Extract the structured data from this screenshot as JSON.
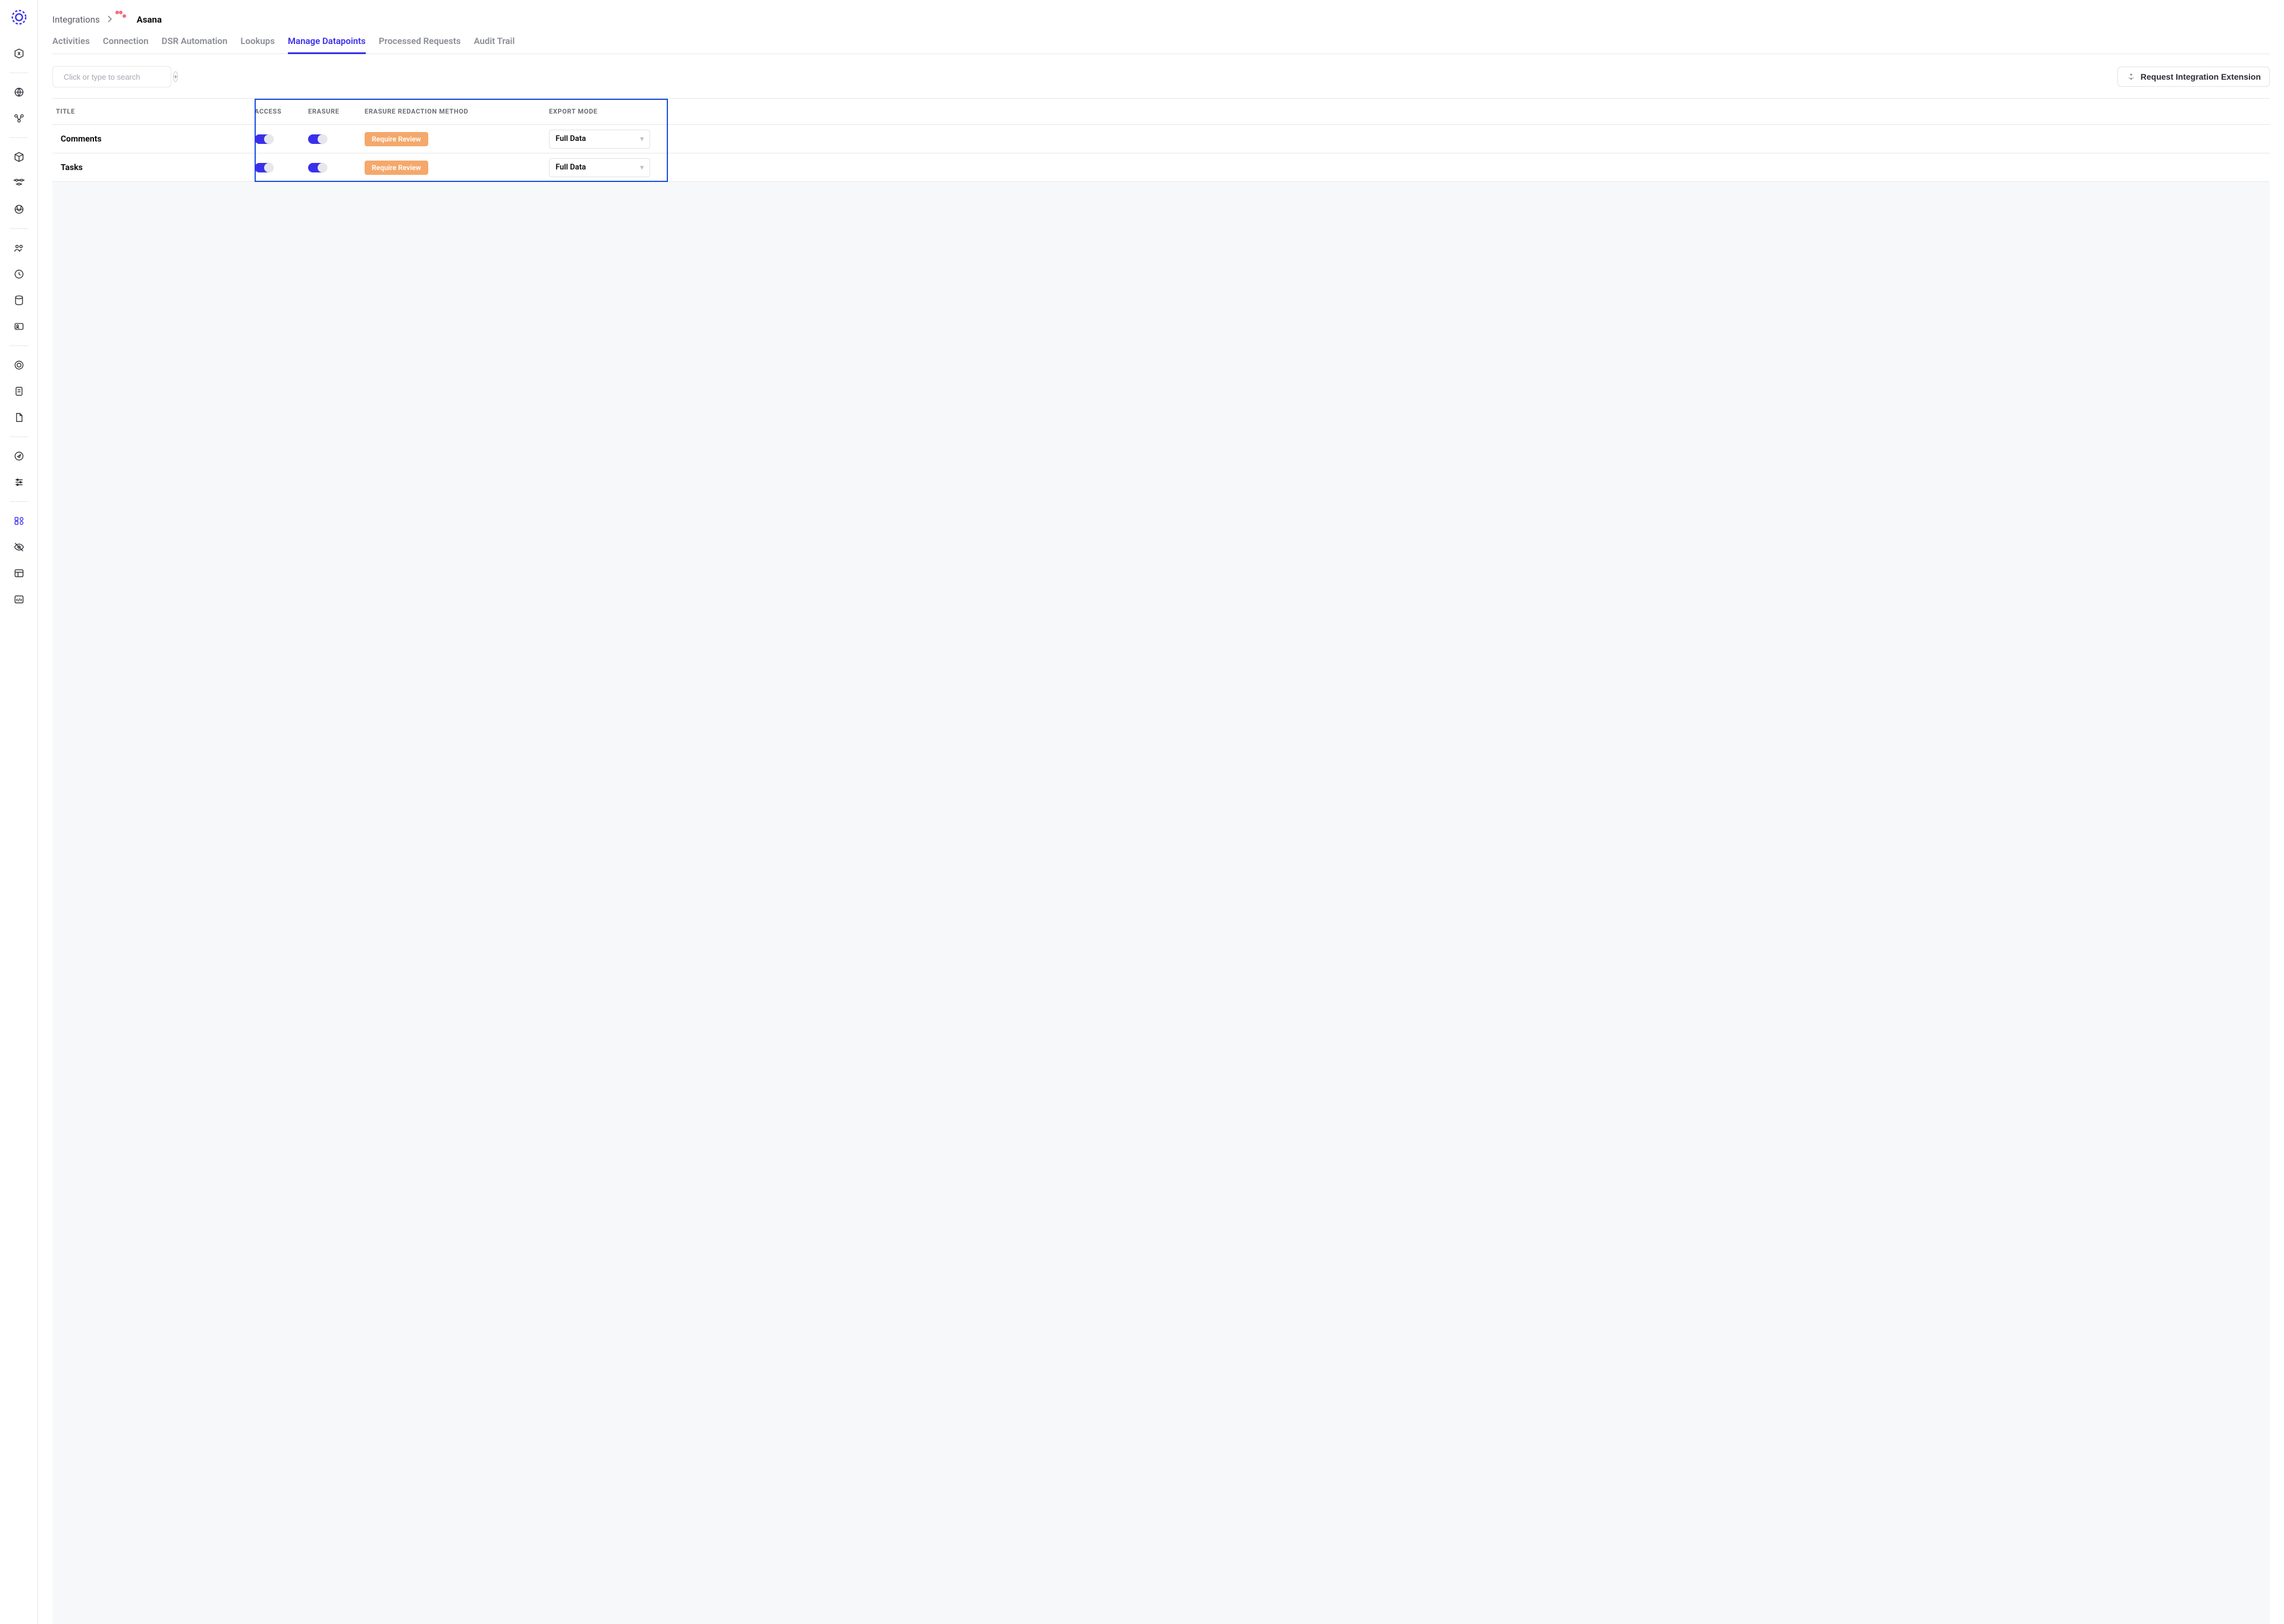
{
  "breadcrumb": {
    "parent": "Integrations",
    "current": "Asana"
  },
  "tabs": [
    {
      "label": "Activities",
      "active": false
    },
    {
      "label": "Connection",
      "active": false
    },
    {
      "label": "DSR Automation",
      "active": false
    },
    {
      "label": "Lookups",
      "active": false
    },
    {
      "label": "Manage Datapoints",
      "active": true
    },
    {
      "label": "Processed Requests",
      "active": false
    },
    {
      "label": "Audit Trail",
      "active": false
    }
  ],
  "search": {
    "placeholder": "Click or type to search"
  },
  "actions": {
    "request_extension": "Request Integration Extension"
  },
  "table": {
    "headers": {
      "title": "TITLE",
      "access": "ACCESS",
      "erasure": "ERASURE",
      "redaction": "ERASURE REDACTION METHOD",
      "export_mode": "EXPORT MODE"
    },
    "rows": [
      {
        "title": "Comments",
        "access": true,
        "erasure": true,
        "redaction_label": "Require Review",
        "export_mode": "Full Data"
      },
      {
        "title": "Tasks",
        "access": true,
        "erasure": true,
        "redaction_label": "Require Review",
        "export_mode": "Full Data"
      }
    ]
  }
}
